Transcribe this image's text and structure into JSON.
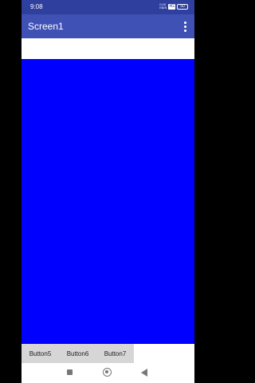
{
  "status_bar": {
    "time": "9:08",
    "net_speed_value": "0.20",
    "net_speed_unit": "KB/S",
    "badge": "4G",
    "battery": "50"
  },
  "app_bar": {
    "title": "Screen1"
  },
  "colors": {
    "status_bar": "#2e3f9d",
    "app_bar": "#3f51b5",
    "canvas": "#0000ff",
    "button": "#d6d6d6"
  },
  "buttons": [
    "Button5",
    "Button6",
    "Button7"
  ],
  "icons": {
    "overflow": "more-vert-icon",
    "nav_recent": "square-icon",
    "nav_home": "circle-icon",
    "nav_back": "triangle-back-icon"
  }
}
